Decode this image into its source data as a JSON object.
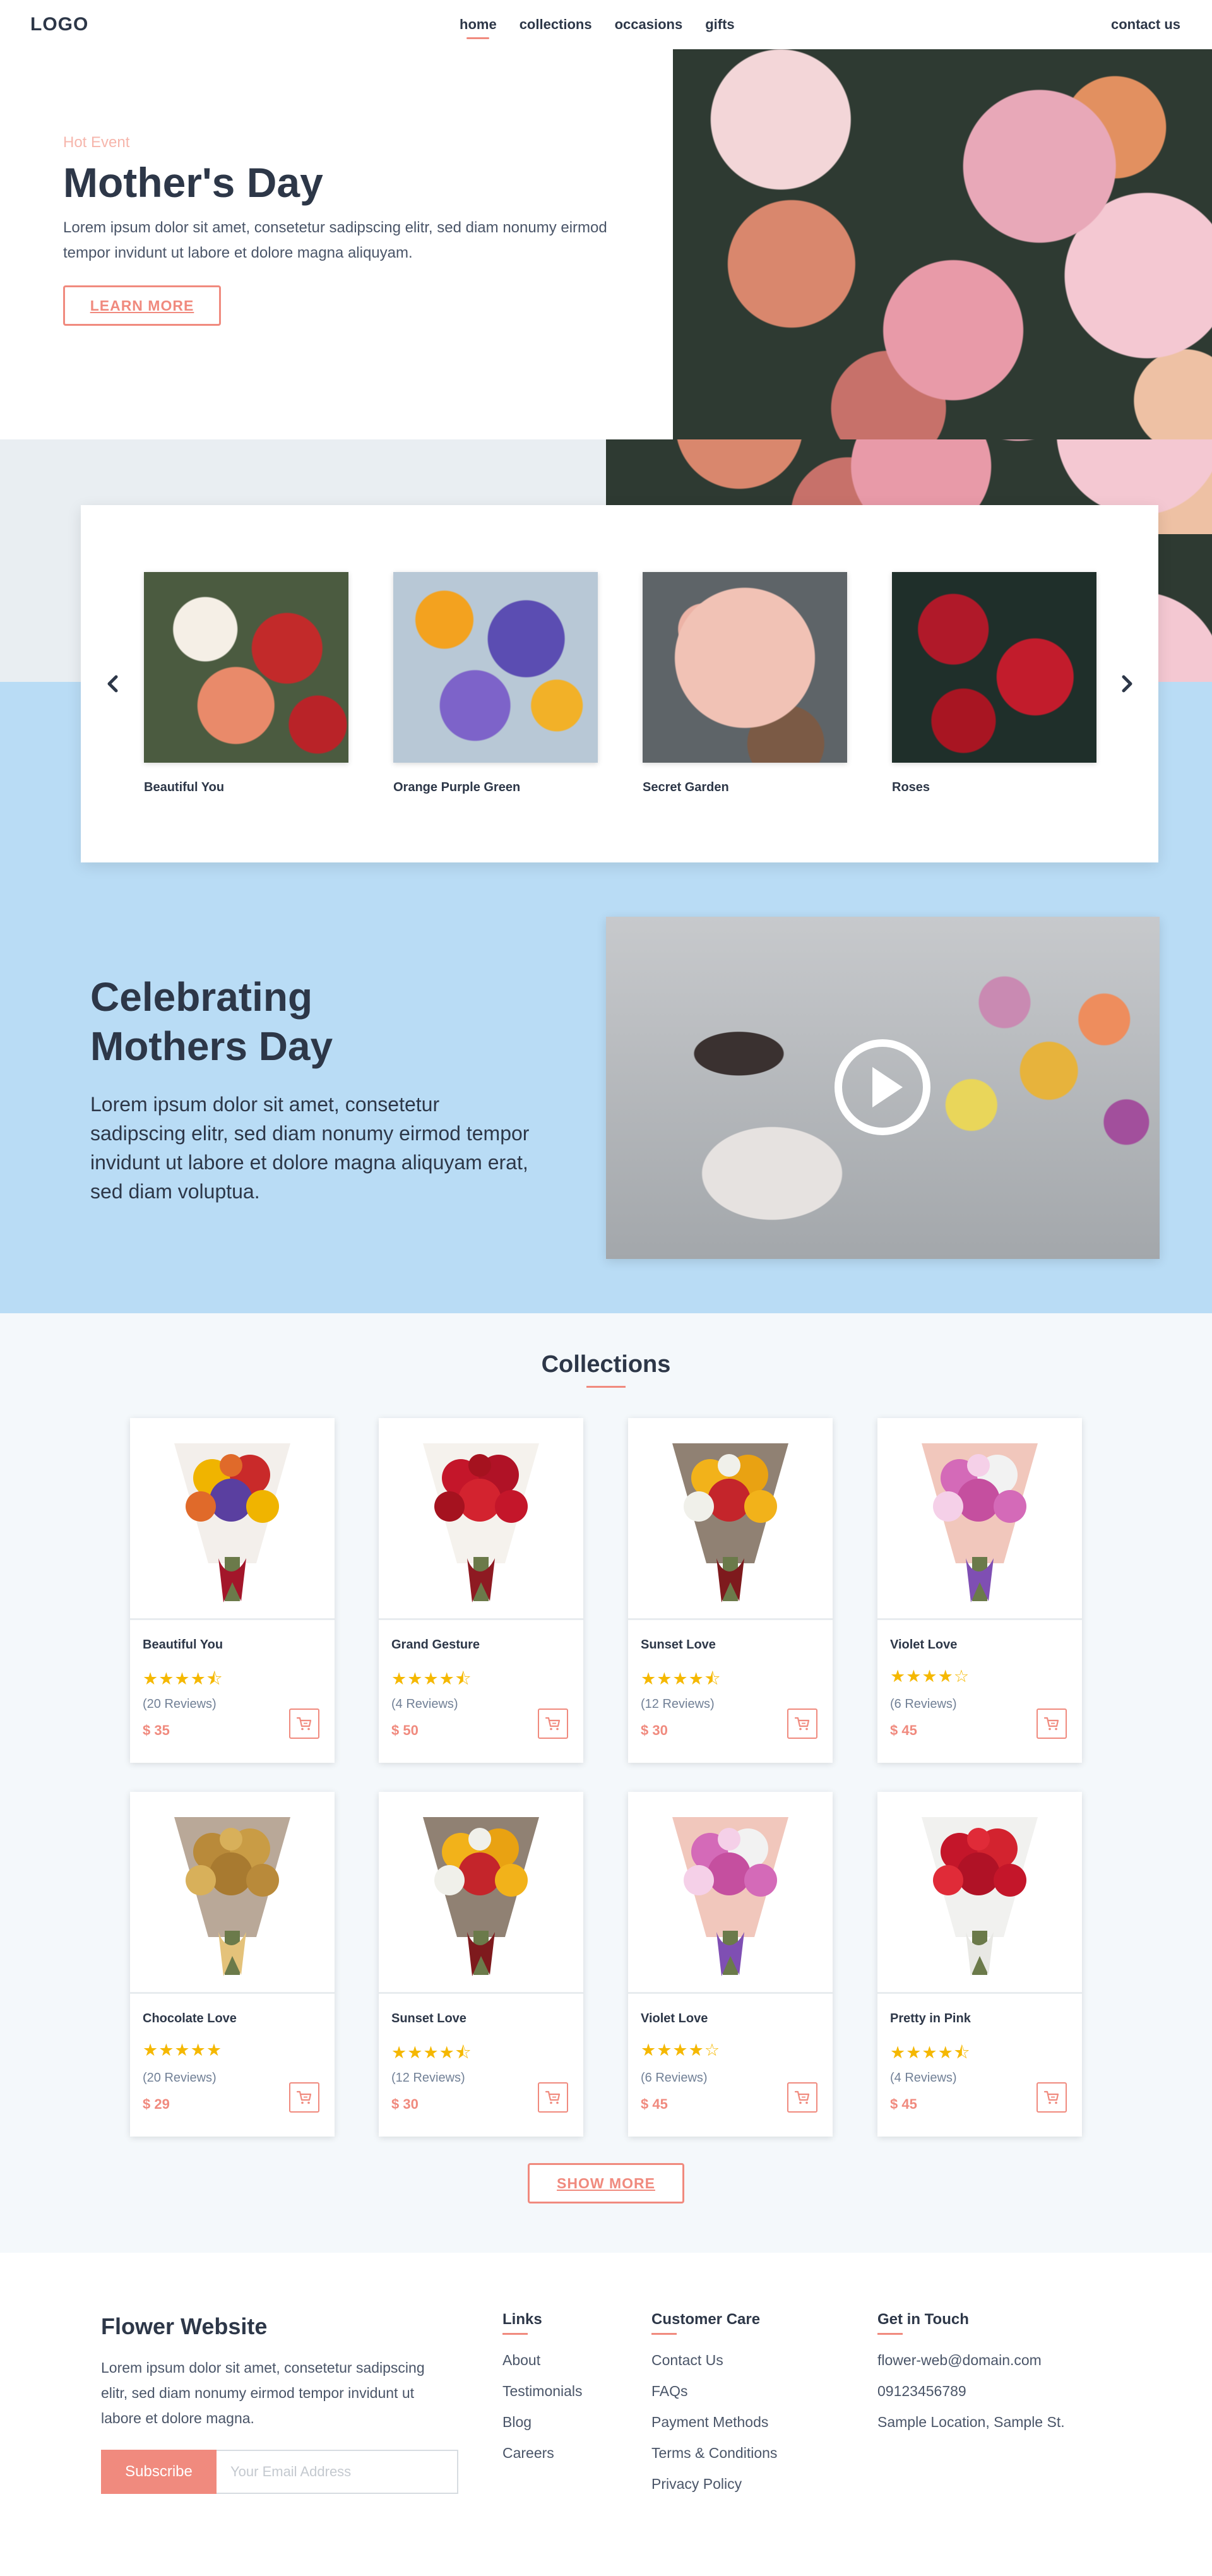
{
  "header": {
    "logo": "LOGO",
    "nav": [
      {
        "label": "home",
        "active": true
      },
      {
        "label": "collections"
      },
      {
        "label": "occasions"
      },
      {
        "label": "gifts"
      }
    ],
    "contact": "contact us"
  },
  "hero": {
    "tag": "Hot Event",
    "title": "Mother's Day",
    "description": "Lorem ipsum dolor sit amet, consetetur sadipscing elitr, sed diam nonumy eirmod tempor invidunt ut labore et dolore magna aliquyam.",
    "button": "LEARN MORE"
  },
  "carousel": {
    "items": [
      {
        "name": "Beautiful You"
      },
      {
        "name": "Orange Purple Green"
      },
      {
        "name": "Secret Garden"
      },
      {
        "name": "Roses"
      }
    ]
  },
  "celebrate": {
    "title_line1": "Celebrating",
    "title_line2": "Mothers Day",
    "description": "Lorem ipsum dolor sit amet, consetetur sadipscing elitr, sed diam nonumy eirmod tempor invidunt ut labore et dolore magna aliquyam erat, sed diam voluptua."
  },
  "collections": {
    "title": "Collections",
    "products": [
      {
        "name": "Beautiful You",
        "stars": "★★★★⯪",
        "rating": 4.5,
        "reviews": "(20 Reviews)",
        "price": "$ 35"
      },
      {
        "name": "Grand Gesture",
        "stars": "★★★★⯪",
        "rating": 4.5,
        "reviews": "(4 Reviews)",
        "price": "$ 50"
      },
      {
        "name": "Sunset Love",
        "stars": "★★★★⯪",
        "rating": 4.5,
        "reviews": "(12 Reviews)",
        "price": "$ 30"
      },
      {
        "name": "Violet Love",
        "stars": "★★★★☆",
        "rating": 4,
        "reviews": "(6 Reviews)",
        "price": "$ 45"
      },
      {
        "name": "Chocolate Love",
        "stars": "★★★★★",
        "rating": 5,
        "reviews": "(20 Reviews)",
        "price": "$ 29"
      },
      {
        "name": "Sunset Love",
        "stars": "★★★★⯪",
        "rating": 4.5,
        "reviews": "(12 Reviews)",
        "price": "$ 30"
      },
      {
        "name": "Violet Love",
        "stars": "★★★★☆",
        "rating": 4,
        "reviews": "(6 Reviews)",
        "price": "$ 45"
      },
      {
        "name": "Pretty in Pink",
        "stars": "★★★★⯪",
        "rating": 4.5,
        "reviews": "(4 Reviews)",
        "price": "$ 45"
      }
    ],
    "show_more": "SHOW MORE"
  },
  "footer": {
    "brand": "Flower Website",
    "description": "Lorem ipsum dolor sit amet, consetetur sadipscing elitr, sed diam nonumy eirmod tempor invidunt ut labore et dolore magna.",
    "subscribe_label": "Subscribe",
    "email_placeholder": "Your Email Address",
    "links": {
      "title": "Links",
      "items": [
        "About",
        "Testimonials",
        "Blog",
        "Careers"
      ]
    },
    "care": {
      "title": "Customer Care",
      "items": [
        "Contact Us",
        "FAQs",
        "Payment Methods",
        "Terms & Conditions",
        "Privacy Policy"
      ]
    },
    "touch": {
      "title": "Get in Touch",
      "items": [
        "flower-web@domain.com",
        "09123456789",
        "Sample Location, Sample St."
      ]
    }
  },
  "colors": {
    "accent": "#f08a7e",
    "heading": "#2d3748",
    "blue_band": "#b9dcf5",
    "star": "#f5b800"
  },
  "icons": [
    "chevron-left-icon",
    "chevron-right-icon",
    "play-icon",
    "cart-icon"
  ]
}
